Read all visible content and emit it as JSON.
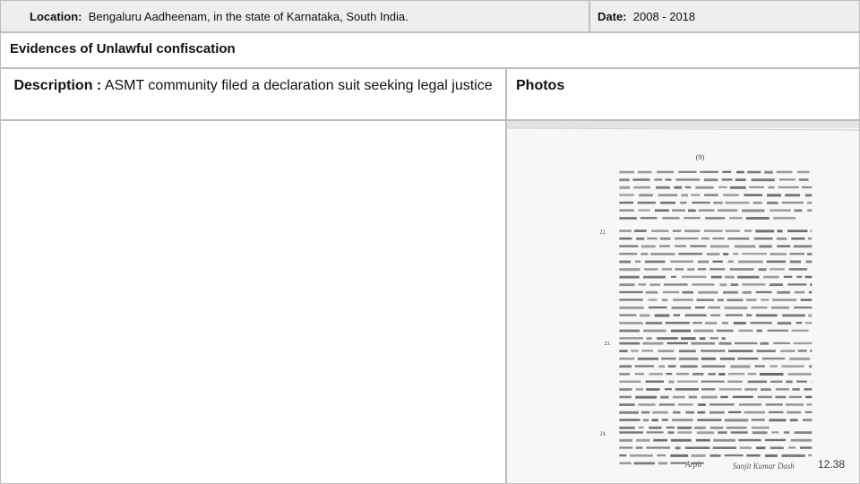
{
  "header": {
    "location_label": "Location:",
    "location_value": "Bengaluru Aadheenam, in the state of Karnataka, South India.",
    "date_label": "Date:",
    "date_value": "2008 - 2018"
  },
  "section_title": "Evidences of Unlawful confiscation",
  "description": {
    "label": "Description",
    "separator": " :",
    "text": "ASMT community filed a declaration suit seeking legal justice"
  },
  "photos_label": "Photos",
  "document": {
    "page_marker": "(9)",
    "paragraph_numbers": [
      "22.",
      "23.",
      "24."
    ],
    "signature_left": "Arpit",
    "signature_right": "Sanjit Kumar Dash"
  },
  "slide_number": "12.38"
}
